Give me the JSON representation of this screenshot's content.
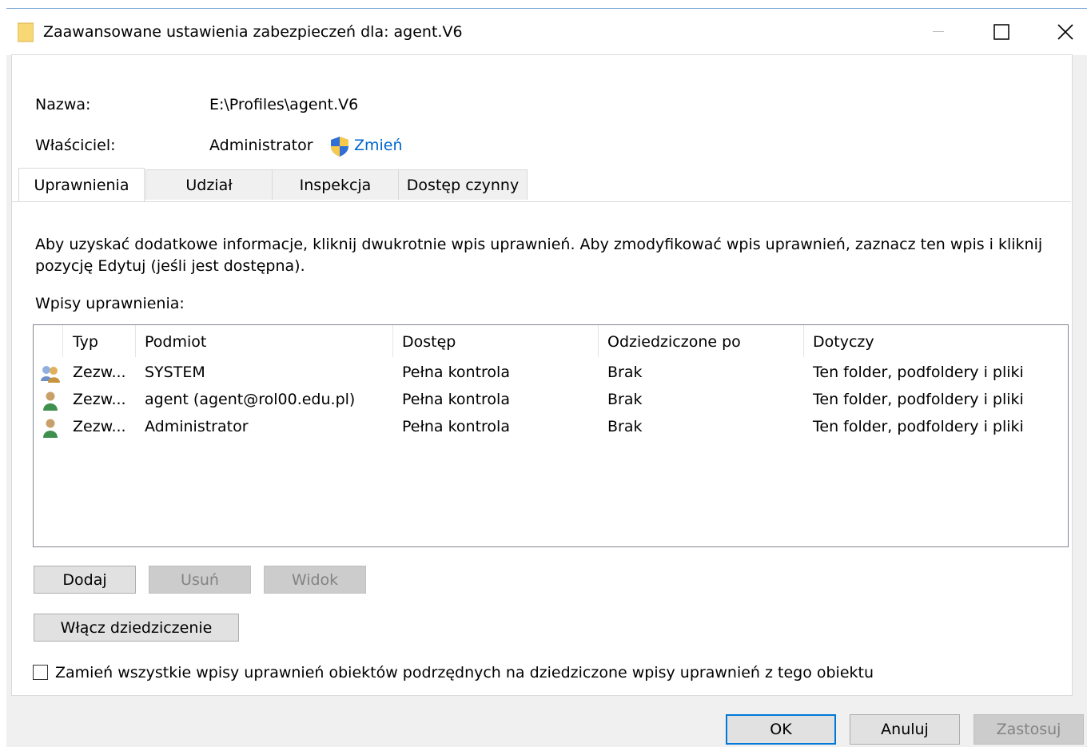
{
  "window": {
    "title": "Zaawansowane ustawienia zabezpieczeń dla: agent.V6"
  },
  "info": {
    "name_label": "Nazwa:",
    "name_value": "E:\\Profiles\\agent.V6",
    "owner_label": "Właściciel:",
    "owner_value": "Administrator",
    "change_link": "Zmień"
  },
  "tabs": [
    {
      "label": "Uprawnienia",
      "active": true
    },
    {
      "label": "Udział",
      "active": false
    },
    {
      "label": "Inspekcja",
      "active": false
    },
    {
      "label": "Dostęp czynny",
      "active": false
    }
  ],
  "instructions": "Aby uzyskać dodatkowe informacje, kliknij dwukrotnie wpis uprawnień. Aby zmodyfikować wpis uprawnień, zaznacz ten wpis i kliknij",
  "instructions_line2": "pozycję Edytuj (jeśli jest dostępna).",
  "entries_label": "Wpisy uprawnienia:",
  "table": {
    "columns": [
      "Typ",
      "Podmiot",
      "Dostęp",
      "Odziedziczone po",
      "Dotyczy"
    ],
    "rows": [
      {
        "icon": "group-icon",
        "type": "Zezw...",
        "principal": "SYSTEM",
        "access": "Pełna kontrola",
        "inherited": "Brak",
        "applies": "Ten folder, podfoldery i pliki"
      },
      {
        "icon": "user-icon",
        "type": "Zezw...",
        "principal": "agent (agent@rol00.edu.pl)",
        "access": "Pełna kontrola",
        "inherited": "Brak",
        "applies": "Ten folder, podfoldery i pliki"
      },
      {
        "icon": "user-icon",
        "type": "Zezw...",
        "principal": "Administrator",
        "access": "Pełna kontrola",
        "inherited": "Brak",
        "applies": "Ten folder, podfoldery i pliki"
      }
    ]
  },
  "buttons": {
    "add": "Dodaj",
    "remove": "Usuń",
    "view": "Widok",
    "enable_inheritance": "Włącz dziedziczenie",
    "ok": "OK",
    "cancel": "Anuluj",
    "apply": "Zastosuj"
  },
  "replace_checkbox": {
    "label": "Zamień wszystkie wpisy uprawnień obiektów podrzędnych na dziedziczone wpisy uprawnień z tego obiektu",
    "checked": false
  },
  "colors": {
    "accent": "#0078d7",
    "link": "#0066cc",
    "disabled_text": "#838383"
  }
}
